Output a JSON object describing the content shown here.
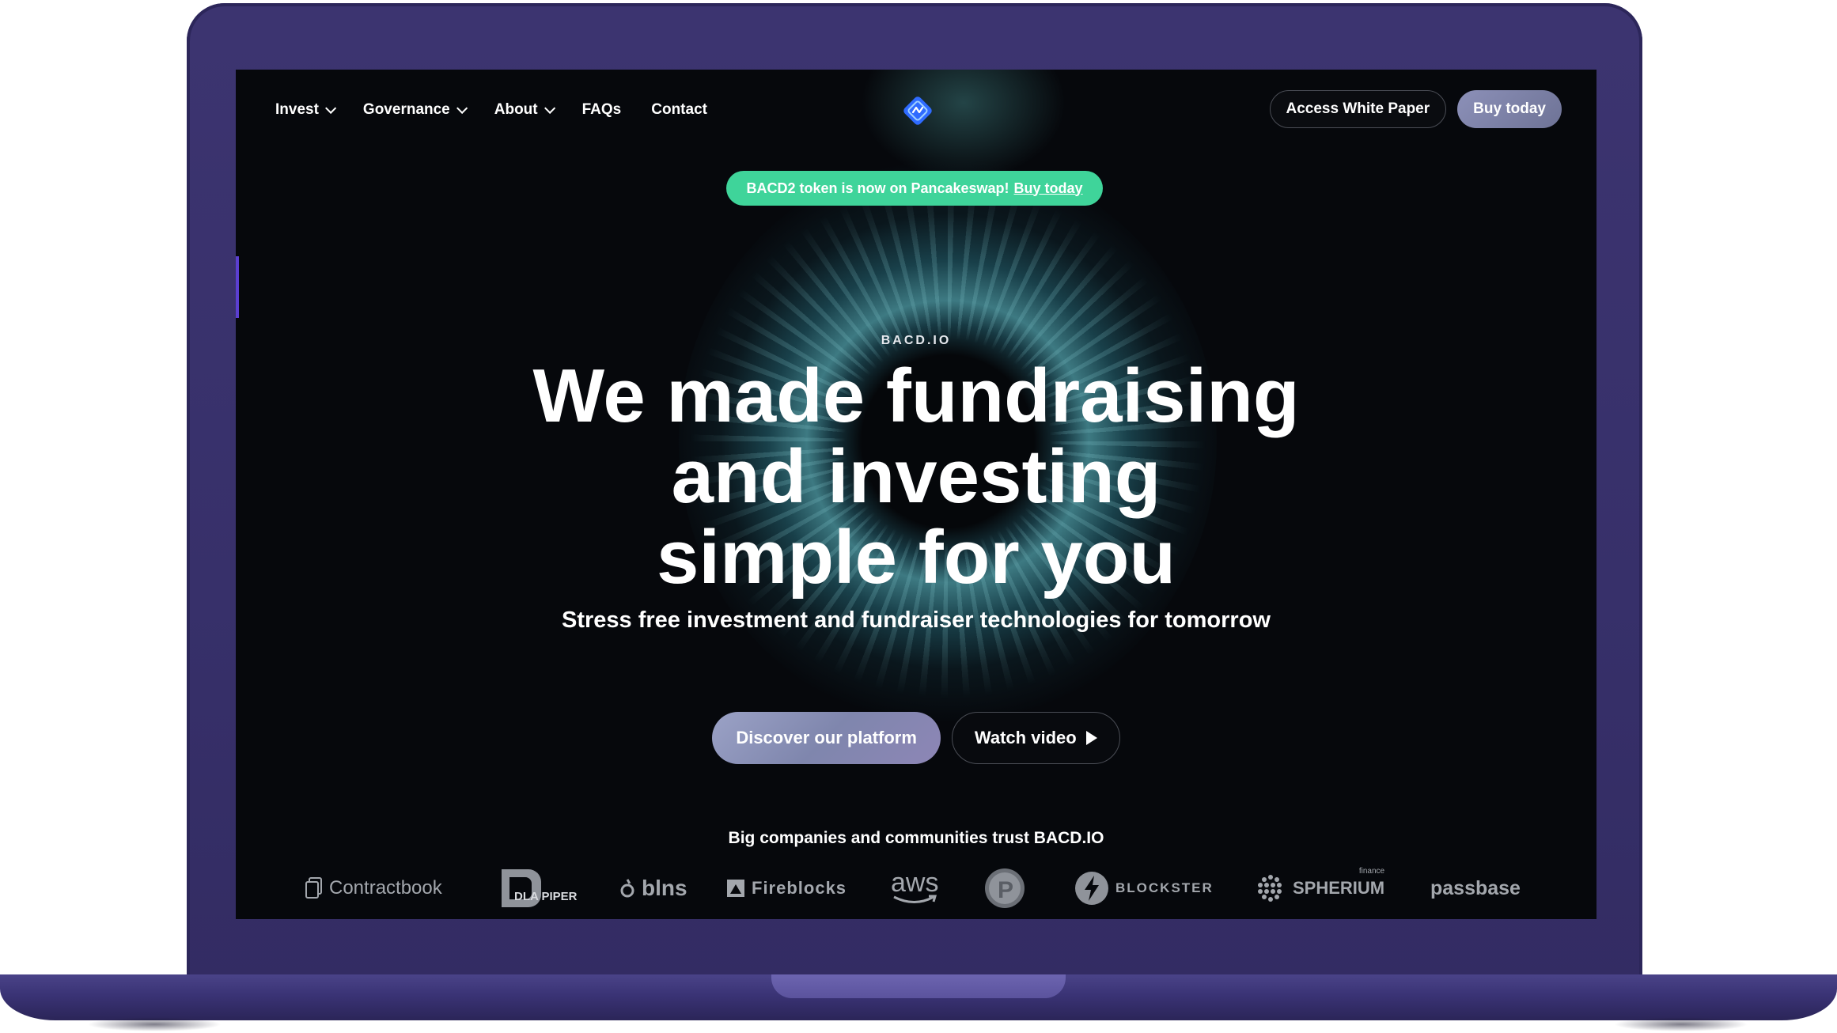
{
  "nav": {
    "items": [
      {
        "label": "Invest",
        "has_dropdown": true
      },
      {
        "label": "Governance",
        "has_dropdown": true
      },
      {
        "label": "About",
        "has_dropdown": true
      },
      {
        "label": "FAQs",
        "has_dropdown": false
      },
      {
        "label": "Contact",
        "has_dropdown": false
      }
    ],
    "logo_icon": "bacd-diamond-logo",
    "white_paper_label": "Access White Paper",
    "buy_label": "Buy today"
  },
  "announcement": {
    "text": "BACD2 token is now on Pancakeswap!",
    "link_label": "Buy today",
    "color": "#3fd49a"
  },
  "hero": {
    "eyebrow": "BACD.IO",
    "title_line1": "We made fundraising",
    "title_line2": "and investing",
    "title_line3": "simple for you",
    "subtitle": "Stress free investment and fundraiser technologies for tomorrow",
    "primary_cta": "Discover our platform",
    "secondary_cta": "Watch video"
  },
  "trust": {
    "title": "Big companies and communities trust BACD.IO",
    "partners": [
      {
        "name": "Contractbook",
        "icon": "document-icon"
      },
      {
        "name": "DLA PIPER",
        "icon": "dla-piper-logo"
      },
      {
        "name": "blns",
        "icon": "blns-logo"
      },
      {
        "name": "Fireblocks",
        "icon": "fireblocks-logo"
      },
      {
        "name": "aws",
        "icon": "aws-logo"
      },
      {
        "name": "P",
        "icon": "p-coin-logo"
      },
      {
        "name": "BLOCKSTER",
        "icon": "lightning-logo"
      },
      {
        "name": "SPHERIUM",
        "icon": "sphere-dots-logo",
        "tag": "finance"
      },
      {
        "name": "passbase",
        "icon": "passbase-logo"
      }
    ]
  },
  "colors": {
    "device": "#3c3470",
    "screen_bg": "#06080c",
    "accent_glow": "#50a0aa",
    "button_gradient": "#8c90b8"
  }
}
